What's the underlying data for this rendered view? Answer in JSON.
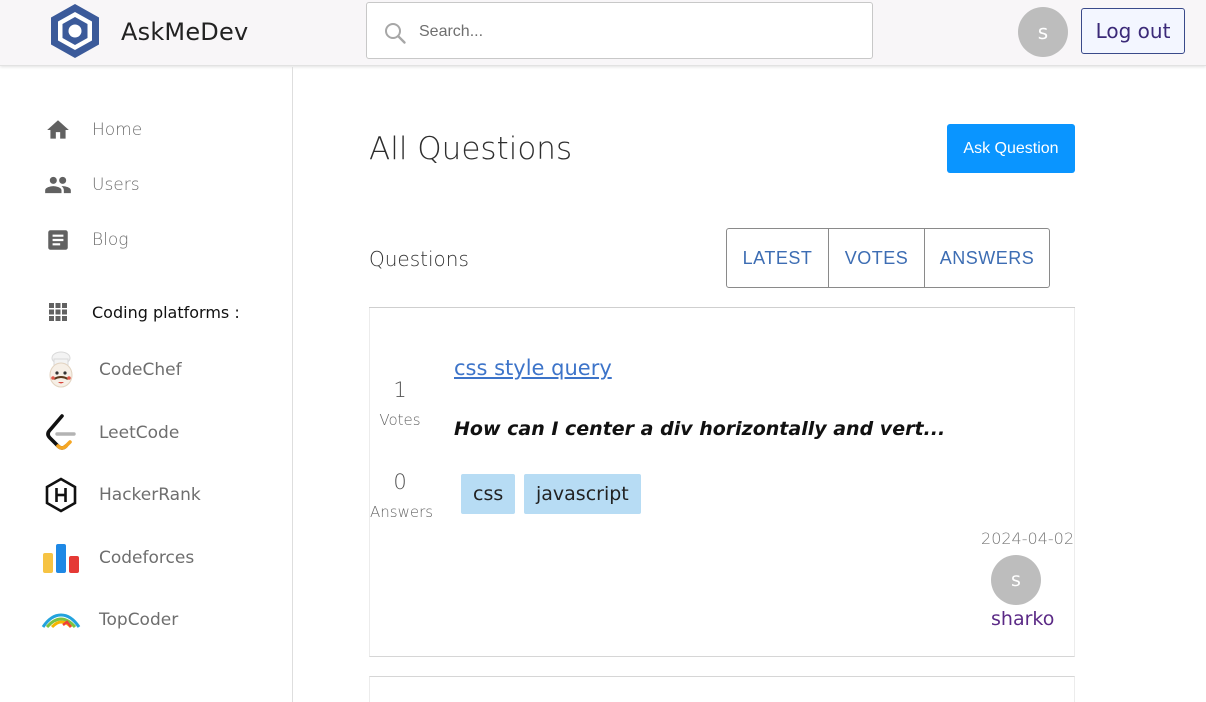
{
  "app": {
    "brand": "AskMeDev",
    "search_placeholder": "Search...",
    "user_initial": "s",
    "logout_label": "Log out"
  },
  "sidebar": {
    "nav": [
      {
        "label": "Home",
        "icon": "home-icon"
      },
      {
        "label": "Users",
        "icon": "users-icon"
      },
      {
        "label": "Blog",
        "icon": "article-icon"
      }
    ],
    "section_label": "Coding platforms :",
    "section_icon": "apps-grid-icon",
    "platforms": [
      {
        "label": "CodeChef",
        "icon": "codechef-logo"
      },
      {
        "label": "LeetCode",
        "icon": "leetcode-logo"
      },
      {
        "label": "HackerRank",
        "icon": "hackerrank-logo"
      },
      {
        "label": "Codeforces",
        "icon": "codeforces-logo"
      },
      {
        "label": "TopCoder",
        "icon": "topcoder-logo"
      }
    ]
  },
  "main": {
    "title": "All Questions",
    "ask_label": "Ask Question",
    "subheading": "Questions",
    "sort_options": [
      "LATEST",
      "VOTES",
      "ANSWERS"
    ],
    "questions": [
      {
        "votes": "1",
        "votes_label": "Votes",
        "answers": "0",
        "answers_label": "Answers",
        "title": "css style query",
        "excerpt": "How can I center a div horizontally and vert...",
        "tags": [
          "css",
          "javascript"
        ],
        "date": "2024-04-02",
        "author_initial": "s",
        "author": "sharko"
      }
    ]
  },
  "colors": {
    "primary": "#0a95ff",
    "link": "#3d74c9",
    "tag_bg": "#b7dcf4",
    "logo_blue": "#3b5a9a",
    "author": "#5b2a86"
  }
}
